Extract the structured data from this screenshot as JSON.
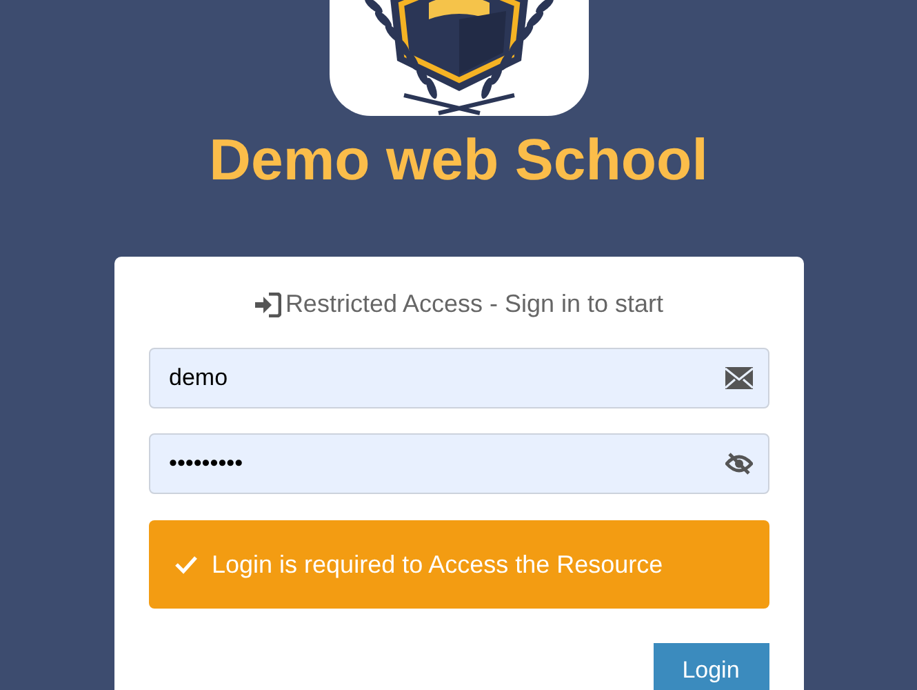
{
  "brand": {
    "title": "Demo web School"
  },
  "card": {
    "header": "Restricted Access - Sign in to start",
    "username": {
      "value": "demo"
    },
    "password": {
      "value": "•••••••••"
    },
    "alert": {
      "kind": "warning",
      "message": "Login is required to Access the Resource"
    },
    "button": "Login"
  }
}
